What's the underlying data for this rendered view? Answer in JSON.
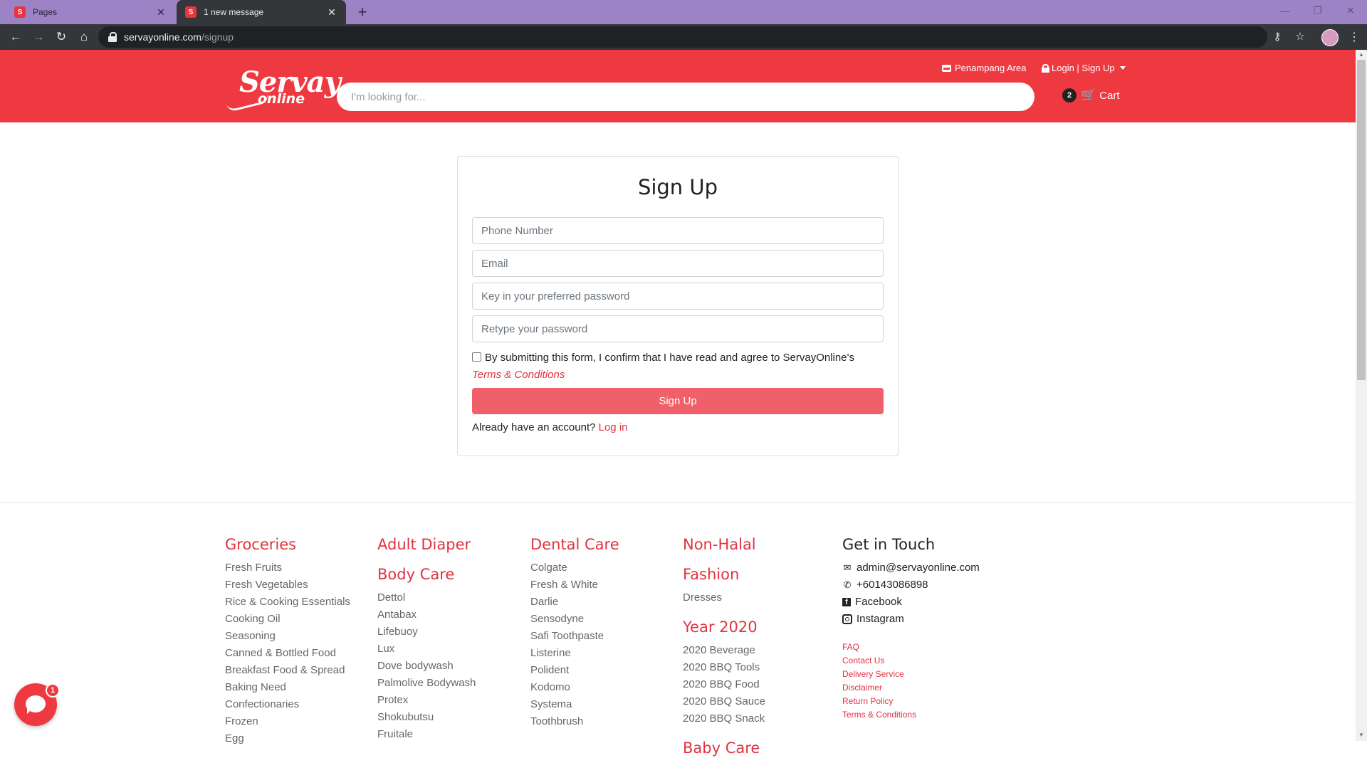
{
  "browser": {
    "tabs": [
      {
        "label": "Pages"
      },
      {
        "label": "1 new message"
      }
    ],
    "url_host": "servayonline.com",
    "url_path": "/signup"
  },
  "header": {
    "logo_line1": "Servay",
    "logo_line2": "online",
    "search_placeholder": "I'm looking for...",
    "area_label": "Penampang Area",
    "login_label": "Login | Sign Up",
    "cart_count": "2",
    "cart_label": "Cart"
  },
  "signup": {
    "title": "Sign Up",
    "phone_placeholder": "Phone Number",
    "email_placeholder": "Email",
    "password_placeholder": "Key in your preferred password",
    "retype_placeholder": "Retype your password",
    "terms_text": "By submitting this form, I confirm that I have read and agree to ServayOnline's",
    "terms_link": "Terms & Conditions",
    "button_label": "Sign Up",
    "already_text": "Already have an account?",
    "login_link": "Log in"
  },
  "footer": {
    "groceries": {
      "title": "Groceries",
      "items": [
        "Fresh Fruits",
        "Fresh Vegetables",
        "Rice & Cooking Essentials",
        "Cooking Oil",
        "Seasoning",
        "Canned & Bottled Food",
        "Breakfast Food & Spread",
        "Baking Need",
        "Confectionaries",
        "Frozen",
        "Egg"
      ]
    },
    "adult_diaper": {
      "title": "Adult Diaper"
    },
    "body_care": {
      "title": "Body Care",
      "items": [
        "Dettol",
        "Antabax",
        "Lifebuoy",
        "Lux",
        "Dove bodywash",
        "Palmolive Bodywash",
        "Protex",
        "Shokubutsu",
        "Fruitale"
      ]
    },
    "dental_care": {
      "title": "Dental Care",
      "items": [
        "Colgate",
        "Fresh & White",
        "Darlie",
        "Sensodyne",
        "Safi Toothpaste",
        "Listerine",
        "Polident",
        "Kodomo",
        "Systema",
        "Toothbrush"
      ]
    },
    "non_halal": {
      "title": "Non-Halal"
    },
    "fashion": {
      "title": "Fashion",
      "items": [
        "Dresses"
      ]
    },
    "year_2020": {
      "title": "Year 2020",
      "items": [
        "2020 Beverage",
        "2020 BBQ Tools",
        "2020 BBQ Food",
        "2020 BBQ Sauce",
        "2020 BBQ Snack"
      ]
    },
    "baby_care": {
      "title": "Baby Care"
    },
    "contact": {
      "title": "Get in Touch",
      "email": "admin@servayonline.com",
      "phone": "+60143086898",
      "facebook": "Facebook",
      "instagram": "Instagram",
      "links": [
        "FAQ",
        "Contact Us",
        "Delivery Service",
        "Disclaimer",
        "Return Policy",
        "Terms & Conditions"
      ]
    }
  },
  "chat": {
    "badge": "1"
  },
  "colors": {
    "brand_red": "#ef3941",
    "link_red": "#e13340",
    "button_red": "#f0606a"
  }
}
